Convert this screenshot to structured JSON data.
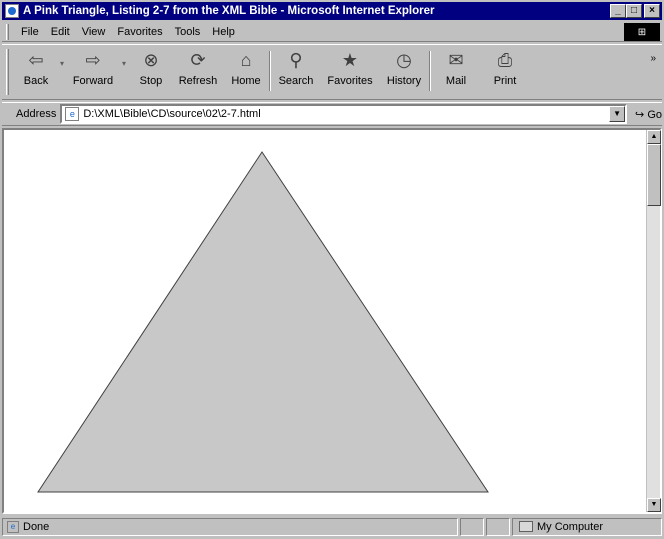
{
  "window": {
    "title": "A Pink Triangle, Listing 2-7 from the XML Bible - Microsoft Internet Explorer",
    "controls": [
      "minimize",
      "maximize",
      "close"
    ]
  },
  "menubar": {
    "items": [
      {
        "label": "File"
      },
      {
        "label": "Edit"
      },
      {
        "label": "View"
      },
      {
        "label": "Favorites"
      },
      {
        "label": "Tools"
      },
      {
        "label": "Help"
      }
    ]
  },
  "toolbar": {
    "buttons": [
      {
        "label": "Back",
        "icon": "back-arrow-icon"
      },
      {
        "label": "Forward",
        "icon": "forward-arrow-icon"
      },
      {
        "label": "Stop",
        "icon": "stop-icon"
      },
      {
        "label": "Refresh",
        "icon": "refresh-icon"
      },
      {
        "label": "Home",
        "icon": "home-icon"
      },
      {
        "label": "Search",
        "icon": "search-icon"
      },
      {
        "label": "Favorites",
        "icon": "favorites-icon"
      },
      {
        "label": "History",
        "icon": "history-icon"
      },
      {
        "label": "Mail",
        "icon": "mail-icon"
      },
      {
        "label": "Print",
        "icon": "print-icon"
      }
    ],
    "more": "»"
  },
  "address": {
    "label": "Address",
    "value": "D:\\XML\\Bible\\CD\\source\\02\\2-7.html",
    "go_label": "Go"
  },
  "content": {
    "shape": "triangle",
    "fill": "#c8c8c8",
    "stroke": "#404040"
  },
  "statusbar": {
    "text": "Done",
    "zone": "My Computer"
  },
  "colors": {
    "titlebar": "#000080",
    "chrome": "#c0c0c0"
  }
}
